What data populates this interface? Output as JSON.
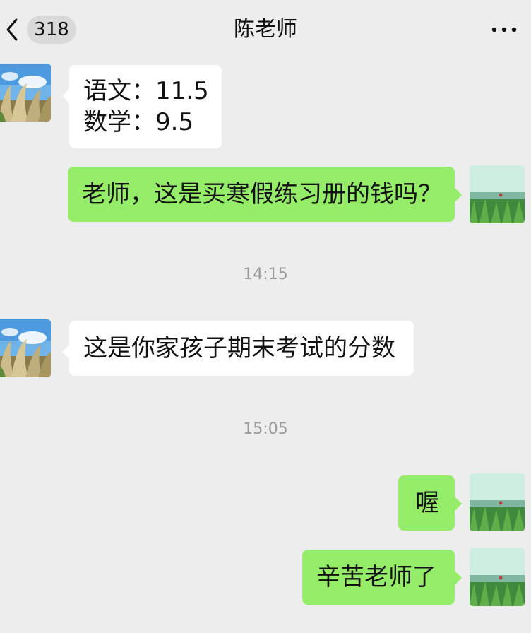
{
  "header": {
    "unread_count": "318",
    "title": "陈老师"
  },
  "messages": [
    {
      "sender": "teacher",
      "lines": [
        "语文：11.5",
        "数学：9.5"
      ]
    },
    {
      "sender": "me",
      "text": "老师，这是买寒假练习册的钱吗？"
    },
    {
      "timestamp": "14:15"
    },
    {
      "sender": "teacher",
      "text": "这是你家孩子期末考试的分数"
    },
    {
      "timestamp": "15:05"
    },
    {
      "sender": "me",
      "text": "喔"
    },
    {
      "sender": "me",
      "text": "辛苦老师了"
    }
  ],
  "icons": {
    "back": "chevron-left-icon",
    "more": "more-dots-icon"
  },
  "colors": {
    "background": "#ededed",
    "incoming_bubble": "#ffffff",
    "outgoing_bubble": "#95ec69",
    "timestamp_text": "#9a9a9a"
  }
}
